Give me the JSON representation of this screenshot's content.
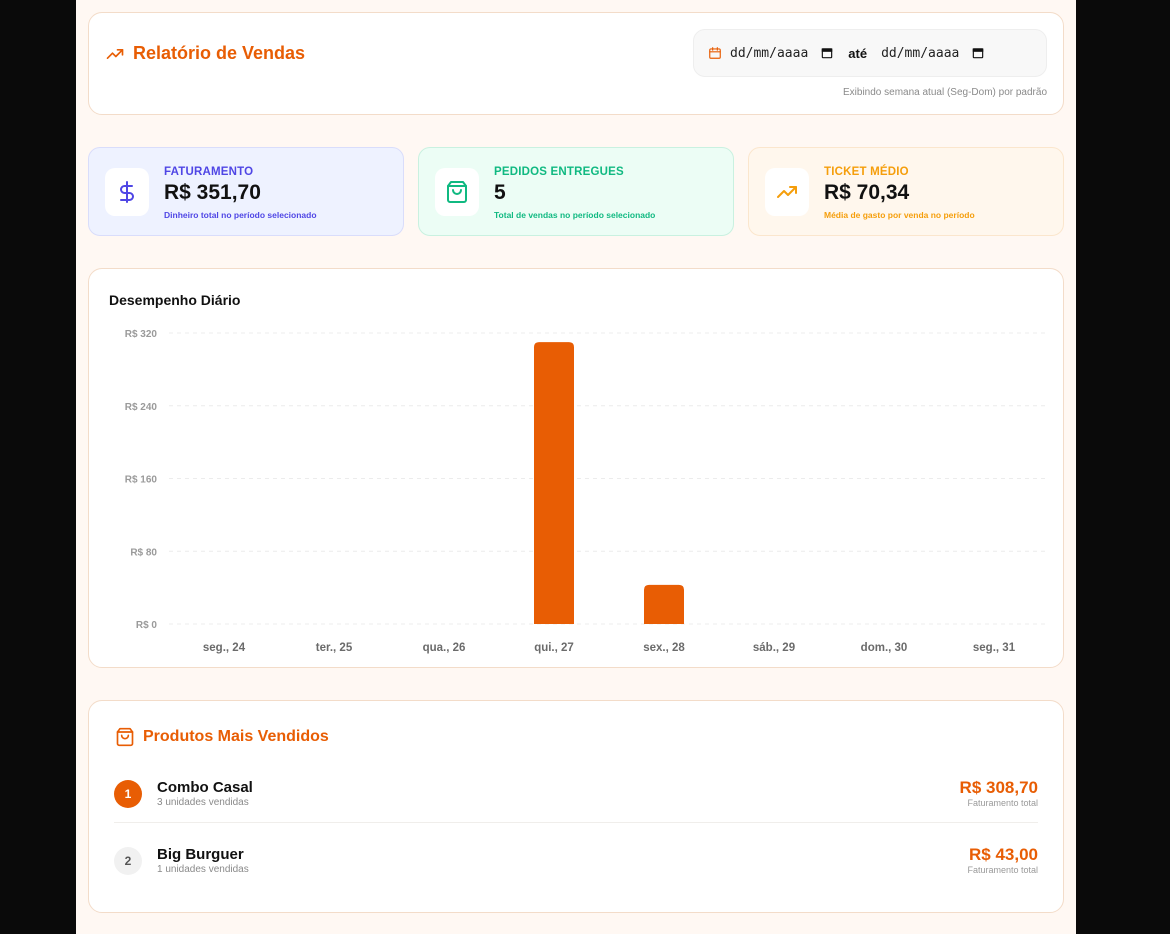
{
  "header": {
    "title": "Relatório de Vendas",
    "date_start_placeholder": "dd/mm/aaaa",
    "date_separator": "até",
    "date_end_placeholder": "dd/mm/aaaa",
    "note": "Exibindo semana atual (Seg-Dom) por padrão"
  },
  "stats": [
    {
      "label": "FATURAMENTO",
      "value": "R$ 351,70",
      "desc": "Dinheiro total no período selecionado",
      "icon": "dollar-icon",
      "accent": "#4f46e5",
      "bg": "#eef2ff",
      "border": "#d9ddfb"
    },
    {
      "label": "PEDIDOS ENTREGUES",
      "value": "5",
      "desc": "Total de vendas no período selecionado",
      "icon": "shopping-bag-icon",
      "accent": "#10b981",
      "bg": "#ecfdf5",
      "border": "#c9f1e0"
    },
    {
      "label": "TICKET MÉDIO",
      "value": "R$ 70,34",
      "desc": "Média de gasto por venda no período",
      "icon": "trending-up-icon",
      "accent": "#f59e0b",
      "bg": "#fff7ed",
      "border": "#fbe6cd"
    }
  ],
  "chart": {
    "title": "Desempenho Diário"
  },
  "chart_data": {
    "type": "bar",
    "title": "Desempenho Diário",
    "categories": [
      "seg., 24",
      "ter., 25",
      "qua., 26",
      "qui., 27",
      "sex., 28",
      "sáb., 29",
      "dom., 30",
      "seg., 31"
    ],
    "values": [
      0,
      0,
      0,
      310,
      43,
      0,
      0,
      0
    ],
    "yticks": [
      "R$ 0",
      "R$ 80",
      "R$ 160",
      "R$ 240",
      "R$ 320"
    ],
    "ylim": [
      0,
      320
    ],
    "grid": true,
    "bar_color": "#e85d04"
  },
  "products": {
    "title": "Produtos Mais Vendidos",
    "items": [
      {
        "rank": "1",
        "name": "Combo Casal",
        "units": "3 unidades vendidas",
        "total": "R$ 308,70",
        "total_label": "Faturamento total"
      },
      {
        "rank": "2",
        "name": "Big Burguer",
        "units": "1 unidades vendidas",
        "total": "R$ 43,00",
        "total_label": "Faturamento total"
      }
    ]
  }
}
